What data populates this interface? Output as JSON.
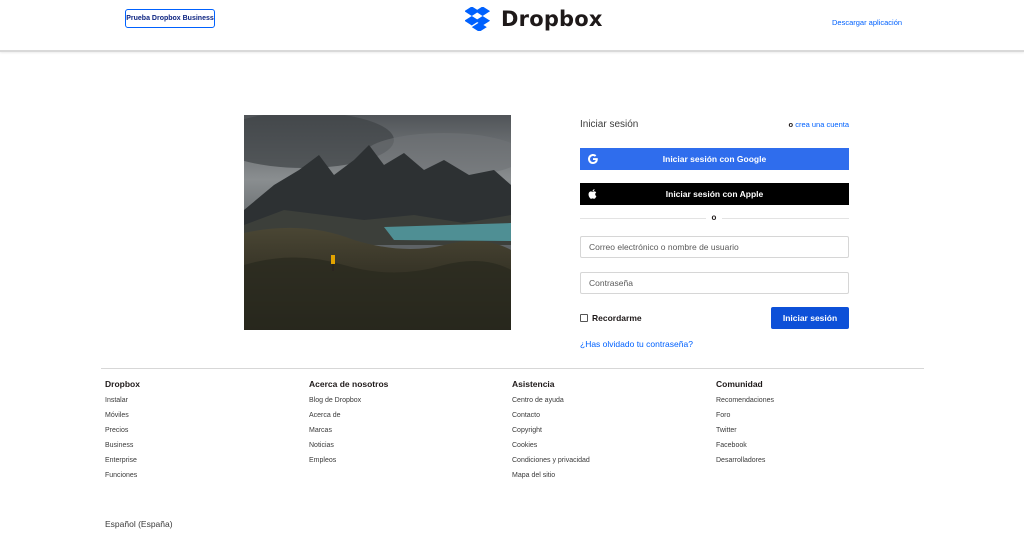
{
  "header": {
    "business_button": "Prueba Dropbox Business",
    "logo_text": "Dropbox",
    "download_link": "Descargar aplicación"
  },
  "login": {
    "title": "Iniciar sesión",
    "or_label": "o",
    "create_account": "crea una cuenta",
    "google_button": "Iniciar sesión con Google",
    "apple_button": "Iniciar sesión con Apple",
    "divider_label": "o",
    "email_placeholder": "Correo electrónico o nombre de usuario",
    "password_placeholder": "Contraseña",
    "remember_label": "Recordarme",
    "remember_checked": false,
    "submit_button": "Iniciar sesión",
    "forgot_link": "¿Has olvidado tu contraseña?"
  },
  "footer": {
    "columns": [
      {
        "heading": "Dropbox",
        "links": [
          "Instalar",
          "Móviles",
          "Precios",
          "Business",
          "Enterprise",
          "Funciones"
        ]
      },
      {
        "heading": "Acerca de nosotros",
        "links": [
          "Blog de Dropbox",
          "Acerca de",
          "Marcas",
          "Noticias",
          "Empleos"
        ]
      },
      {
        "heading": "Asistencia",
        "links": [
          "Centro de ayuda",
          "Contacto",
          "Copyright",
          "Cookies",
          "Condiciones y privacidad",
          "Mapa del sitio"
        ]
      },
      {
        "heading": "Comunidad",
        "links": [
          "Recomendaciones",
          "Foro",
          "Twitter",
          "Facebook",
          "Desarrolladores"
        ]
      }
    ],
    "locale": "Español (España)"
  },
  "colors": {
    "brand_blue": "#0061fe",
    "google_button": "#2f6ded",
    "apple_button": "#000000",
    "submit_button": "#0d50d8"
  },
  "icons": {
    "logo": "dropbox-box-icon",
    "google": "google-g-icon",
    "apple": "apple-logo-icon",
    "remember": "checkbox-icon"
  }
}
